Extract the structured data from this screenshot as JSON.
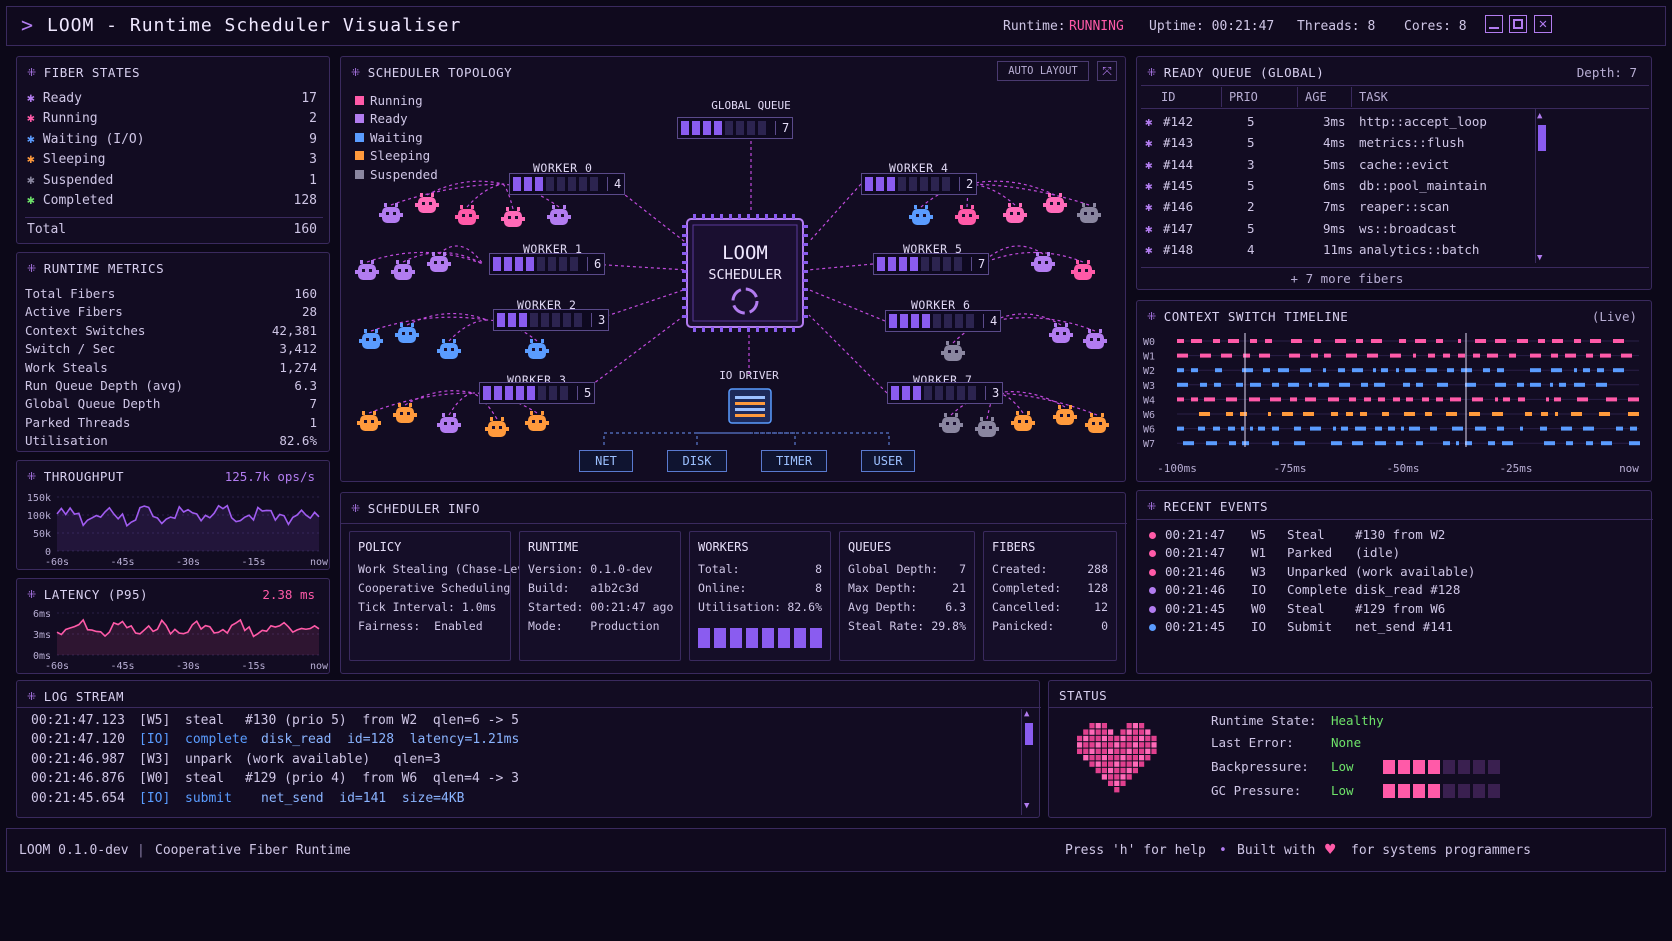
{
  "app": {
    "title": "LOOM - Runtime Scheduler Visualiser",
    "runtime_label": "Runtime:",
    "runtime_value": "RUNNING",
    "uptime": "Uptime: 00:21:47",
    "threads": "Threads: 8",
    "cores": "Cores: 8"
  },
  "fiber_states": {
    "title": "FIBER STATES",
    "items": [
      {
        "label": "Ready",
        "count": "17",
        "color": "#b27cf0"
      },
      {
        "label": "Running",
        "count": "2",
        "color": "#ff5aa8"
      },
      {
        "label": "Waiting (I/O)",
        "count": "9",
        "color": "#5a9cff"
      },
      {
        "label": "Sleeping",
        "count": "3",
        "color": "#ff9a3c"
      },
      {
        "label": "Suspended",
        "count": "1",
        "color": "#8a86a0"
      },
      {
        "label": "Completed",
        "count": "128",
        "color": "#6ee36a"
      }
    ],
    "total_label": "Total",
    "total": "160"
  },
  "runtime_metrics": {
    "title": "RUNTIME METRICS",
    "items": [
      {
        "label": "Total Fibers",
        "value": "160"
      },
      {
        "label": "Active Fibers",
        "value": "28"
      },
      {
        "label": "Context Switches",
        "value": "42,381"
      },
      {
        "label": "Switch / Sec",
        "value": "3,412"
      },
      {
        "label": "Work Steals",
        "value": "1,274"
      },
      {
        "label": "Run Queue Depth (avg)",
        "value": "6.3"
      },
      {
        "label": "Global Queue Depth",
        "value": "7"
      },
      {
        "label": "Parked Threads",
        "value": "1"
      },
      {
        "label": "Utilisation",
        "value": "82.6%"
      }
    ]
  },
  "throughput": {
    "title": "THROUGHPUT",
    "value": "125.7k ops/s",
    "y_ticks": [
      "150k",
      "100k",
      "50k",
      "0"
    ],
    "x_ticks": [
      "-60s",
      "-45s",
      "-30s",
      "-15s",
      "now"
    ]
  },
  "latency": {
    "title": "LATENCY (P95)",
    "value": "2.38 ms",
    "y_ticks": [
      "6ms",
      "3ms",
      "0ms"
    ],
    "x_ticks": [
      "-60s",
      "-45s",
      "-30s",
      "-15s",
      "now"
    ]
  },
  "topology": {
    "title": "SCHEDULER TOPOLOGY",
    "auto_layout": "AUTO LAYOUT",
    "legend": [
      {
        "label": "Running",
        "color": "#ff5aa8"
      },
      {
        "label": "Ready",
        "color": "#b27cf0"
      },
      {
        "label": "Waiting",
        "color": "#5a9cff"
      },
      {
        "label": "Sleeping",
        "color": "#ff9a3c"
      },
      {
        "label": "Suspended",
        "color": "#8a86a0"
      }
    ],
    "global_queue": {
      "label": "GLOBAL QUEUE",
      "count": "7"
    },
    "core_line1": "LOOM",
    "core_line2": "SCHEDULER",
    "io_driver": "IO DRIVER",
    "workers": [
      {
        "label": "WORKER 0",
        "count": "4"
      },
      {
        "label": "WORKER 1",
        "count": "6"
      },
      {
        "label": "WORKER 2",
        "count": "3"
      },
      {
        "label": "WORKER 3",
        "count": "5"
      },
      {
        "label": "WORKER 4",
        "count": "2"
      },
      {
        "label": "WORKER 5",
        "count": "7"
      },
      {
        "label": "WORKER 6",
        "count": "4"
      },
      {
        "label": "WORKER 7",
        "count": "3"
      }
    ],
    "io_targets": [
      "NET",
      "DISK",
      "TIMER",
      "USER"
    ]
  },
  "ready_queue": {
    "title": "READY QUEUE (GLOBAL)",
    "depth": "Depth: 7",
    "columns": [
      "ID",
      "PRIO",
      "AGE",
      "TASK"
    ],
    "rows": [
      {
        "id": "#142",
        "prio": "5",
        "age": "3ms",
        "task": "http::accept_loop"
      },
      {
        "id": "#143",
        "prio": "5",
        "age": "4ms",
        "task": "metrics::flush"
      },
      {
        "id": "#144",
        "prio": "3",
        "age": "5ms",
        "task": "cache::evict"
      },
      {
        "id": "#145",
        "prio": "5",
        "age": "6ms",
        "task": "db::pool_maintain"
      },
      {
        "id": "#146",
        "prio": "2",
        "age": "7ms",
        "task": "reaper::scan"
      },
      {
        "id": "#147",
        "prio": "5",
        "age": "9ms",
        "task": "ws::broadcast"
      },
      {
        "id": "#148",
        "prio": "4",
        "age": "11ms",
        "task": "analytics::batch"
      }
    ],
    "more": "+ 7 more fibers"
  },
  "timeline": {
    "title": "CONTEXT SWITCH TIMELINE",
    "live": "(Live)",
    "lanes": [
      "W0",
      "W1",
      "W2",
      "W3",
      "W4",
      "W6",
      "W6",
      "W7"
    ],
    "x_ticks": [
      "-100ms",
      "-75ms",
      "-50ms",
      "-25ms",
      "now"
    ]
  },
  "scheduler_info": {
    "title": "SCHEDULER INFO",
    "policy": {
      "title": "POLICY",
      "lines": [
        "Work Stealing (Chase-Lev)",
        "Cooperative Scheduling",
        "Tick Interval: 1.0ms",
        "Fairness:  Enabled"
      ]
    },
    "runtime": {
      "title": "RUNTIME",
      "lines": [
        "Version: 0.1.0-dev",
        "Build:   a1b2c3d",
        "Started: 00:21:47 ago",
        "Mode:    Production"
      ]
    },
    "workers": {
      "title": "WORKERS",
      "rows": [
        {
          "k": "Total:",
          "v": "8"
        },
        {
          "k": "Online:",
          "v": "8"
        },
        {
          "k": "Utilisation:",
          "v": "82.6%"
        }
      ]
    },
    "queues": {
      "title": "QUEUES",
      "rows": [
        {
          "k": "Global Depth:",
          "v": "7"
        },
        {
          "k": "Max Depth:",
          "v": "21"
        },
        {
          "k": "Avg Depth:",
          "v": "6.3"
        },
        {
          "k": "Steal Rate:",
          "v": "29.8%"
        }
      ]
    },
    "fibers": {
      "title": "FIBERS",
      "rows": [
        {
          "k": "Created:",
          "v": "288"
        },
        {
          "k": "Completed:",
          "v": "128"
        },
        {
          "k": "Cancelled:",
          "v": "12"
        },
        {
          "k": "Panicked:",
          "v": "0"
        }
      ]
    }
  },
  "recent_events": {
    "title": "RECENT EVENTS",
    "items": [
      {
        "time": "00:21:47",
        "src": "W5",
        "type": "Steal",
        "detail": "#130 from W2",
        "color": "#ff5aa8"
      },
      {
        "time": "00:21:47",
        "src": "W1",
        "type": "Parked",
        "detail": "(idle)",
        "color": "#ff5aa8"
      },
      {
        "time": "00:21:46",
        "src": "W3",
        "type": "Unparked",
        "detail": "(work available)",
        "color": "#ff5aa8"
      },
      {
        "time": "00:21:46",
        "src": "IO",
        "type": "Complete",
        "detail": "disk_read #128",
        "color": "#b27cf0"
      },
      {
        "time": "00:21:45",
        "src": "W0",
        "type": "Steal",
        "detail": "#129 from W6",
        "color": "#b27cf0"
      },
      {
        "time": "00:21:45",
        "src": "IO",
        "type": "Submit",
        "detail": "net_send #141",
        "color": "#5a9cff"
      }
    ]
  },
  "log_stream": {
    "title": "LOG STREAM",
    "lines": [
      {
        "time": "00:21:47.123",
        "src": "[W5]",
        "action": "steal",
        "rest": "#130 (prio 5)  from W2  qlen=6 -> 5",
        "style": "plain"
      },
      {
        "time": "00:21:47.120",
        "src": "[IO]",
        "action": "complete",
        "rest": "disk_read  id=128  latency=1.21ms",
        "style": "io"
      },
      {
        "time": "00:21:46.987",
        "src": "[W3]",
        "action": "unpark",
        "rest": "(work available)   qlen=3",
        "style": "plain"
      },
      {
        "time": "00:21:46.876",
        "src": "[W0]",
        "action": "steal",
        "rest": "#129 (prio 4)  from W6  qlen=4 -> 3",
        "style": "plain"
      },
      {
        "time": "00:21:45.654",
        "src": "[IO]",
        "action": "submit",
        "rest": "net_send  id=141  size=4KB",
        "style": "io"
      }
    ]
  },
  "status": {
    "title": "STATUS",
    "rows": [
      {
        "label": "Runtime State:",
        "value": "Healthy"
      },
      {
        "label": "Last Error:",
        "value": "None"
      },
      {
        "label": "Backpressure:",
        "value": "Low",
        "level": 0.5
      },
      {
        "label": "GC Pressure:",
        "value": "Low",
        "level": 0.5
      }
    ]
  },
  "footer": {
    "version": "LOOM 0.1.0-dev",
    "tagline": "Cooperative Fiber Runtime",
    "help": "Press 'h' for help",
    "built": "Built with",
    "built_end": "for systems programmers"
  }
}
